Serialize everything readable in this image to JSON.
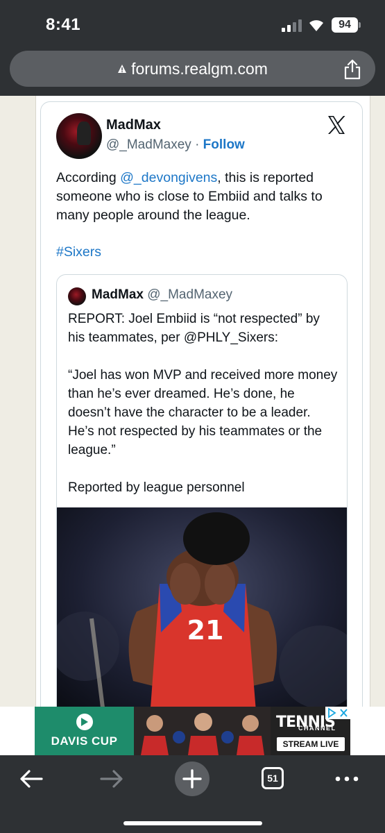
{
  "status_bar": {
    "time": "8:41",
    "battery": "94"
  },
  "browser": {
    "url": "forums.realgm.com"
  },
  "tweet": {
    "author_name": "MadMax",
    "author_handle": "@_MadMaxey",
    "separator": "·",
    "follow_label": "Follow",
    "text_prefix": "According ",
    "mention": "@_devongivens",
    "text_suffix": ", this is reported someone who is close to Embiid and talks to many people around the league.",
    "hashtag": "#Sixers",
    "quoted": {
      "author_name": "MadMax",
      "author_handle": "@_MadMaxey",
      "text": "REPORT: Joel Embiid is “not respected” by his teammates, per @PHLY_Sixers:\n\n“Joel has won MVP and received more money than he’s ever dreamed. He’s done, he doesn’t have the character to be a leader. He’s not respected by his teammates or the league.”\n\nReported by league personnel",
      "photo_jersey_number": "21"
    }
  },
  "ad": {
    "left_brand": "DAVIS CUP",
    "right_brand": "TENNIS",
    "right_sub": "CHANNEL",
    "cta": "STREAM LIVE"
  },
  "toolbar": {
    "tabs_count": "51"
  },
  "colors": {
    "link": "#1d77c7",
    "chrome": "#2e3134",
    "page_bg": "#efede4",
    "ad_green": "#1e8c6b"
  }
}
